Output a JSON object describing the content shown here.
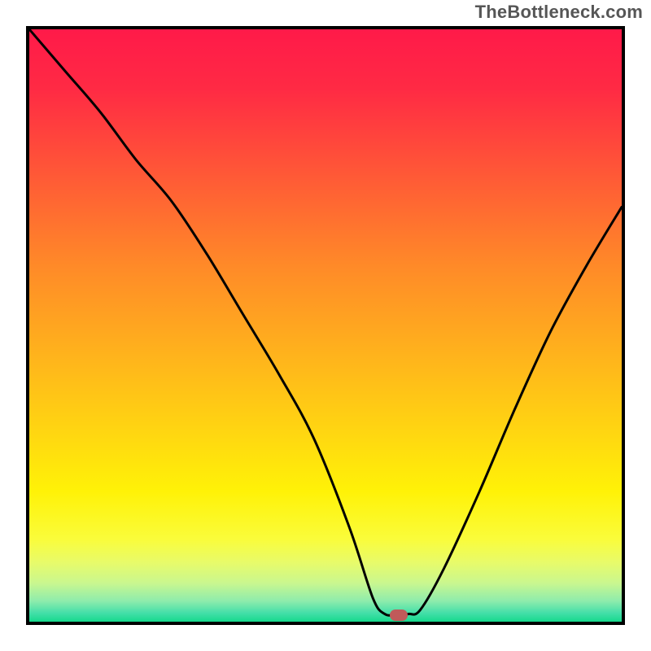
{
  "watermark": "TheBottleneck.com",
  "gradient": {
    "stops": [
      {
        "offset": 0.0,
        "color": "#ff1a49"
      },
      {
        "offset": 0.1,
        "color": "#ff2a44"
      },
      {
        "offset": 0.25,
        "color": "#ff5a36"
      },
      {
        "offset": 0.4,
        "color": "#ff8a28"
      },
      {
        "offset": 0.55,
        "color": "#ffb31c"
      },
      {
        "offset": 0.68,
        "color": "#ffd611"
      },
      {
        "offset": 0.78,
        "color": "#fff207"
      },
      {
        "offset": 0.86,
        "color": "#fafc3a"
      },
      {
        "offset": 0.9,
        "color": "#e8fb6a"
      },
      {
        "offset": 0.935,
        "color": "#c9f78f"
      },
      {
        "offset": 0.965,
        "color": "#8eecac"
      },
      {
        "offset": 0.985,
        "color": "#45dfa9"
      },
      {
        "offset": 1.0,
        "color": "#16d98d"
      }
    ]
  },
  "marker": {
    "x_pct": 62.3,
    "y_pct": 98.9,
    "color": "#c05a5a"
  },
  "chart_data": {
    "type": "line",
    "title": "",
    "xlabel": "",
    "ylabel": "",
    "xlim": [
      0,
      100
    ],
    "ylim": [
      0,
      100
    ],
    "note": "Single unlabeled V-shaped bottleneck curve over a vertical heat gradient. Axes have no tick labels; values are percentage of plot area (x left→right, y = curve height above bottom).",
    "series": [
      {
        "name": "bottleneck-curve",
        "x": [
          0,
          6,
          12,
          18,
          24,
          30,
          36,
          42,
          48,
          54,
          58,
          60,
          62,
          64,
          66,
          70,
          76,
          82,
          88,
          94,
          100
        ],
        "y": [
          100,
          93,
          86,
          78,
          71,
          62,
          52,
          42,
          31,
          16,
          4,
          1.3,
          1.2,
          1.3,
          2,
          9,
          22,
          36,
          49,
          60,
          70
        ]
      }
    ],
    "optimum_marker": {
      "x": 62.3,
      "y": 1.1
    }
  }
}
